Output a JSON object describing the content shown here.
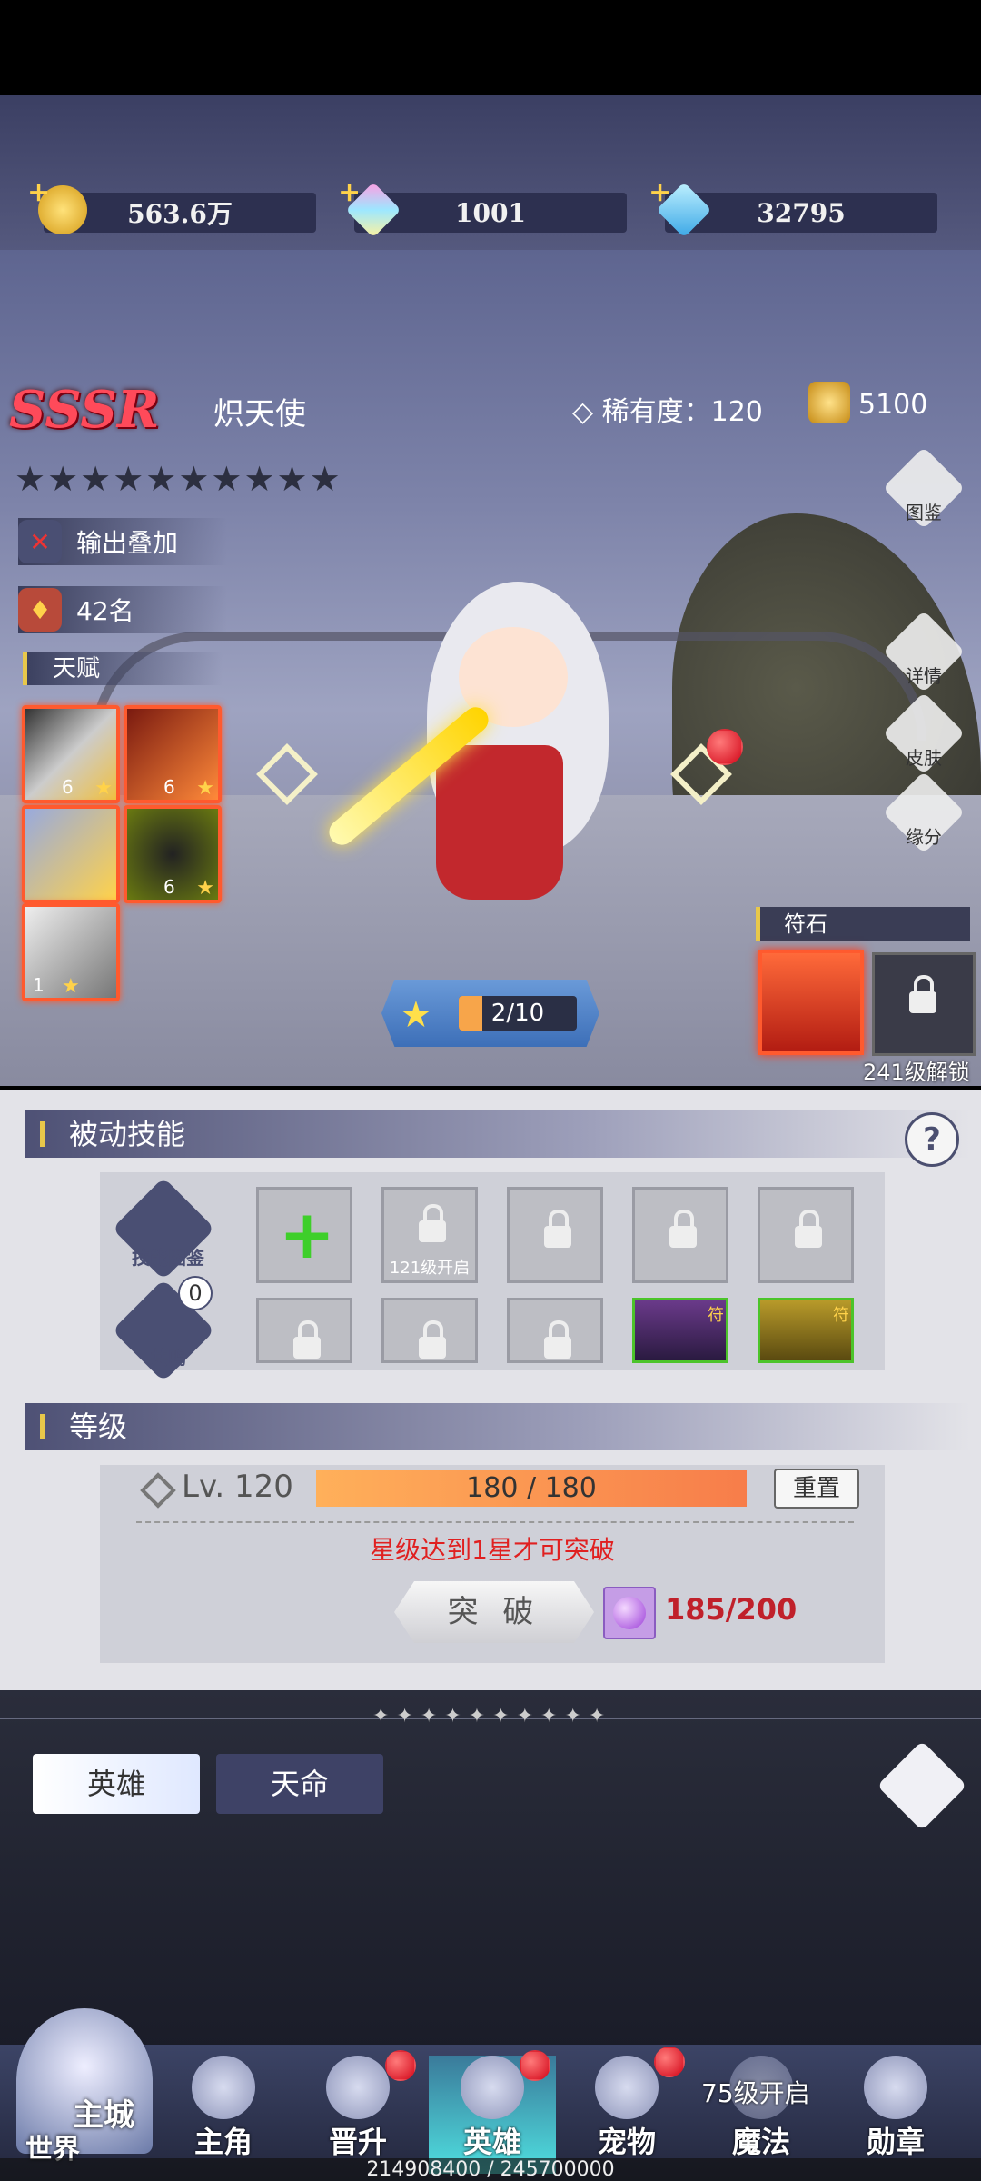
{
  "currency": [
    {
      "icon": "gold-coin-icon",
      "value": "563.6万"
    },
    {
      "icon": "rainbow-gem-icon",
      "value": "1001"
    },
    {
      "icon": "blue-diamond-icon",
      "value": "32795"
    }
  ],
  "hero": {
    "rarity_grade": "SSSR",
    "name": "炽天使",
    "rarity_label": "稀有度：120",
    "power": "5100",
    "stars_filled": 0,
    "stars_total": 10,
    "stars": "★★★★★★★★★★",
    "role_tag": "输出叠加",
    "rank": "42名",
    "star_progress": "2/10"
  },
  "talent": {
    "header": "天赋",
    "items": [
      {
        "count": "6"
      },
      {
        "count": "6"
      },
      {
        "count": ""
      },
      {
        "count": "6"
      },
      {
        "count": "1"
      }
    ]
  },
  "side_buttons": [
    "图鉴",
    "详情",
    "皮肤",
    "缘分"
  ],
  "rune": {
    "header": "符石",
    "unlock_text": "241级解锁"
  },
  "passive": {
    "header": "被动技能",
    "help": "?",
    "skill_atlas_label": "技能图鉴",
    "resonance_label": "共鸣",
    "resonance_count": "0",
    "slot_unlock_text": "121级开启",
    "rune_tag": "符"
  },
  "level": {
    "header": "等级",
    "label": "Lv. 120",
    "exp": "180 / 180",
    "reset": "重置",
    "warning": "星级达到1星才可突破",
    "break_button": "突 破",
    "break_cost": "185/200"
  },
  "tabs": {
    "hero": "英雄",
    "destiny": "天命"
  },
  "nav": {
    "castle": "主城",
    "world": "世界",
    "items": [
      {
        "label": "主角",
        "badge": false
      },
      {
        "label": "晋升",
        "badge": true
      },
      {
        "label": "英雄",
        "badge": true
      },
      {
        "label": "宠物",
        "badge": true
      },
      {
        "label": "魔法",
        "badge": false
      },
      {
        "label": "勋章",
        "badge": false
      }
    ],
    "magic_unlock": "75级开启"
  },
  "exp_total": "214908400 / 245700000"
}
